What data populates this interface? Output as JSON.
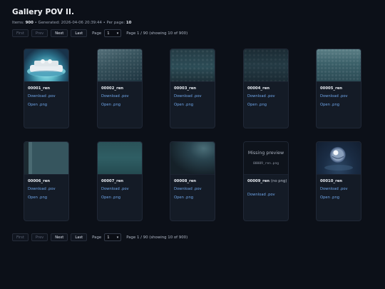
{
  "title": "Gallery POV II.",
  "meta": {
    "items_label": "Items:",
    "items": "900",
    "generated_label": "Generated:",
    "generated": "2026-04-06 20:39:44",
    "per_page_label": "Per page:",
    "per_page": "10",
    "sep": "•"
  },
  "pager": {
    "first": "First",
    "prev": "Prev",
    "next": "Next",
    "last": "Last",
    "page_label": "Page",
    "page_value": "1",
    "info": "Page 1 / 90 (showing 10 of 900)"
  },
  "cards": [
    {
      "caption": "00001_ren",
      "download": "Download .pov",
      "open": "Open .png",
      "thumb": "pool-scene"
    },
    {
      "caption": "00002_ren",
      "download": "Download .pov",
      "open": "Open .png",
      "thumb": "stone-texture"
    },
    {
      "caption": "00003_ren",
      "download": "Download .pov",
      "open": "Open .png",
      "thumb": "stone-texture"
    },
    {
      "caption": "00004_ren",
      "download": "Download .pov",
      "open": "Open .png",
      "thumb": "stone-texture"
    },
    {
      "caption": "00005_ren",
      "download": "Download .pov",
      "open": "Open .png",
      "thumb": "stone-texture"
    },
    {
      "caption": "00006_ren",
      "download": "Download .pov",
      "open": "Open .png",
      "thumb": "wall-edge"
    },
    {
      "caption": "00007_ren",
      "download": "Download .pov",
      "open": "Open .png",
      "thumb": "teal-surface"
    },
    {
      "caption": "00008_ren",
      "download": "Download .pov",
      "open": "Open .png",
      "thumb": "dark-texture"
    },
    {
      "caption": "00009_ren",
      "caption_note": "(no png)",
      "download": "Download .pov",
      "thumb": "missing",
      "missing_title": "Missing preview",
      "missing_file": "00009_ren.png"
    },
    {
      "caption": "00010_ren",
      "download": "Download .pov",
      "open": "Open .png",
      "thumb": "chrome-sphere"
    }
  ]
}
